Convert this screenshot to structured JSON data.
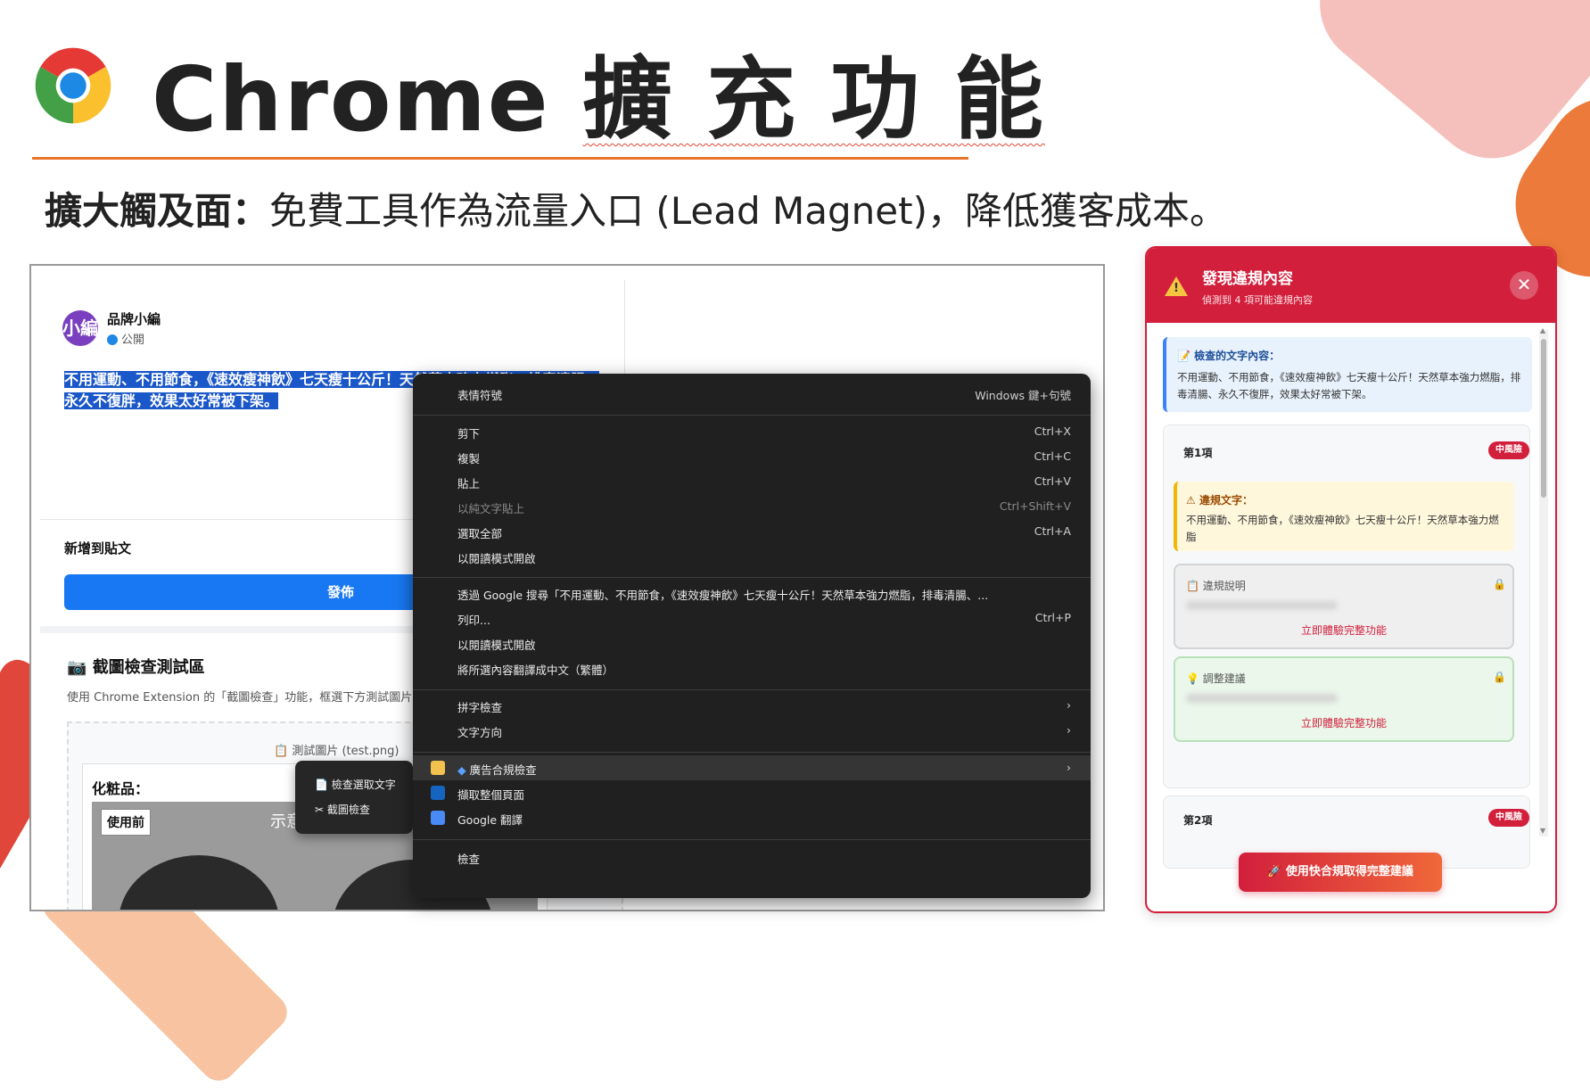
{
  "header": {
    "title_en": "Chrome",
    "title_cjk": "擴 充 功 能",
    "subtitle_bold": "擴大觸及面：",
    "subtitle_rest": "免費工具作為流量入口 (Lead Magnet)，降低獲客成本。"
  },
  "post": {
    "avatar_text": "小編",
    "author": "品牌小編",
    "privacy": "公開",
    "selected_text": "不用運動、不用節食，《速效瘦神飲》七天瘦十公斤！天然草本強力燃脂，排毒清腸、永久不復胖，效果太好常被下架。",
    "add_to_post": "新增到貼文",
    "publish_label": "發佈",
    "test_section_title": "截圖檢查測試區",
    "test_section_desc": "使用 Chrome Extension 的「截圖檢查」功能，框選下方測試圖片",
    "test_image_label": "測試圖片 (test.png)",
    "cosmetics_title": "化粧品：",
    "before_tag": "使用前",
    "demo_tag": "示意"
  },
  "submenu": {
    "items": [
      "檢查選取文字",
      "截圖檢查"
    ]
  },
  "context_menu": {
    "emoji": {
      "label": "表情符號",
      "shortcut": "Windows 鍵+句號"
    },
    "cut": {
      "label": "剪下",
      "shortcut": "Ctrl+X"
    },
    "copy": {
      "label": "複製",
      "shortcut": "Ctrl+C"
    },
    "paste": {
      "label": "貼上",
      "shortcut": "Ctrl+V"
    },
    "paste_plain": {
      "label": "以純文字貼上",
      "shortcut": "Ctrl+Shift+V"
    },
    "select_all": {
      "label": "選取全部",
      "shortcut": "Ctrl+A"
    },
    "reader_mode_1": {
      "label": "以閱讀模式開啟"
    },
    "search_google": {
      "label": "透過 Google 搜尋「不用運動、不用節食，《速效瘦神飲》七天瘦十公斤！天然草本強力燃脂，排毒清腸、..."
    },
    "print": {
      "label": "列印...",
      "shortcut": "Ctrl+P"
    },
    "reader_mode_2": {
      "label": "以閱讀模式開啟"
    },
    "translate": {
      "label": "將所選內容翻譯成中文（繁體）"
    },
    "spell_check": {
      "label": "拼字檢查"
    },
    "text_direction": {
      "label": "文字方向"
    },
    "ad_check": {
      "label": "廣告合規檢查"
    },
    "capture_page": {
      "label": "擷取整個頁面"
    },
    "google_translate": {
      "label": "Google 翻譯"
    },
    "inspect": {
      "label": "檢查"
    }
  },
  "panel": {
    "title": "發現違規內容",
    "subtitle": "偵測到 4 項可能違規內容",
    "close": "✕",
    "checked_label": "檢查的文字內容：",
    "checked_text": "不用運動、不用節食，《速效瘦神飲》七天瘦十公斤！天然草本強力燃脂，排毒清腸、永久不復胖，效果太好常被下架。",
    "item1": {
      "number": "第1項",
      "risk": "中風險",
      "violation_label": "違規文字：",
      "violation_text": "不用運動、不用節食，《速效瘦神飲》七天瘦十公斤！天然草本強力燃脂",
      "explain_label": "違規說明",
      "suggest_label": "調整建議",
      "unlock_text": "立即體驗完整功能"
    },
    "item2": {
      "number": "第2項",
      "risk": "中風險"
    },
    "cta": "使用快合規取得完整建議"
  },
  "colors": {
    "accent_red": "#d21f3c",
    "accent_orange": "#e8742c",
    "facebook_blue": "#1877f2",
    "selection_blue": "#1a57c9"
  }
}
